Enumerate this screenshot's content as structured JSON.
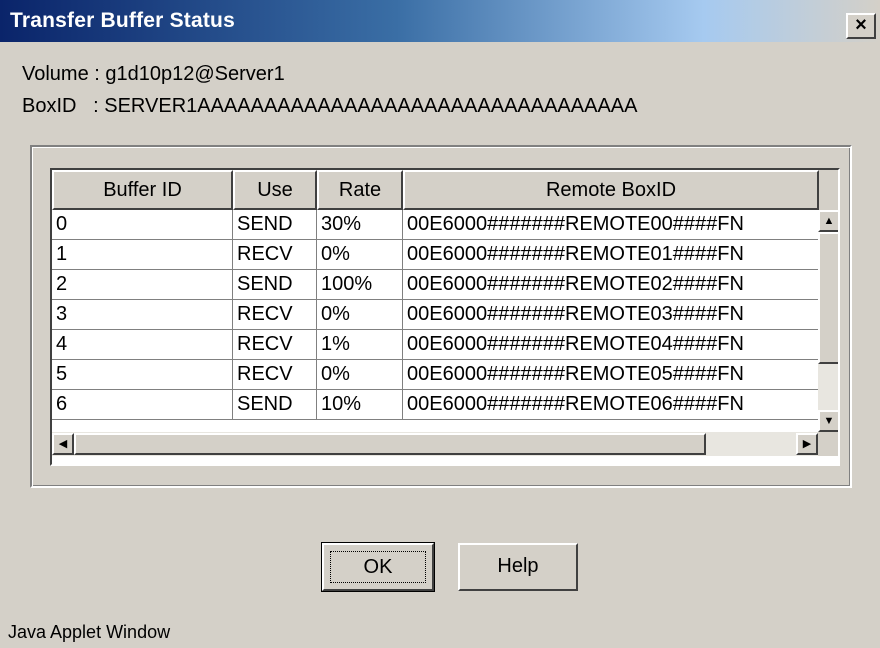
{
  "window": {
    "title": "Transfer Buffer Status",
    "close_label": "×"
  },
  "info": {
    "volume": "Volume : g1d10p12@Server1",
    "boxid": "BoxID   : SERVER1AAAAAAAAAAAAAAAAAAAAAAAAAAAAAAAAA"
  },
  "table": {
    "columns": [
      "Buffer ID",
      "Use",
      "Rate",
      "Remote BoxID"
    ],
    "rows": [
      [
        "0",
        "SEND",
        "30%",
        "00E6000#######REMOTE00####FN"
      ],
      [
        "1",
        "RECV",
        "0%",
        "00E6000#######REMOTE01####FN"
      ],
      [
        "2",
        "SEND",
        "100%",
        "00E6000#######REMOTE02####FN"
      ],
      [
        "3",
        "RECV",
        "0%",
        "00E6000#######REMOTE03####FN"
      ],
      [
        "4",
        "RECV",
        "1%",
        "00E6000#######REMOTE04####FN"
      ],
      [
        "5",
        "RECV",
        "0%",
        "00E6000#######REMOTE05####FN"
      ],
      [
        "6",
        "SEND",
        "10%",
        "00E6000#######REMOTE06####FN"
      ]
    ]
  },
  "icons": {
    "scroll_up": "arrow-up-icon",
    "scroll_down": "arrow-down-icon",
    "scroll_left": "arrow-left-icon",
    "scroll_right": "arrow-right-icon"
  },
  "buttons": {
    "ok_label": "OK",
    "help_label": "Help"
  },
  "footer": {
    "text": "Java Applet Window"
  },
  "colors": {
    "title_bar_start": "#0a246a",
    "dialog_background": "#d4d0c8"
  }
}
